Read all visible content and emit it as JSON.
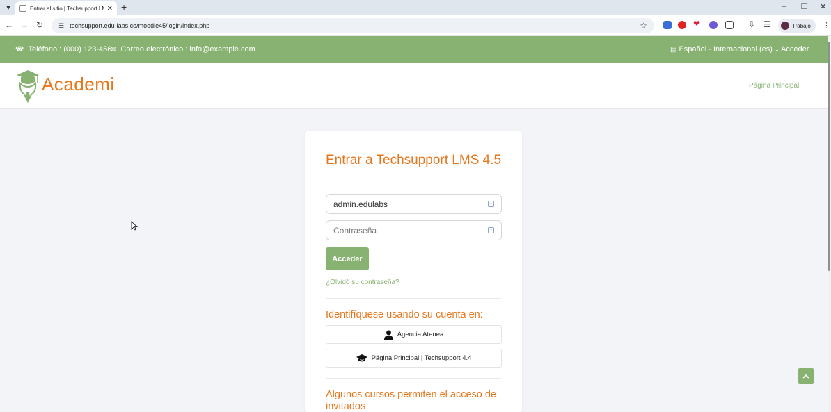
{
  "browser": {
    "tab_title": "Entrar al sitio | Techsupport LMS",
    "url": "techsupport.edu-labs.co/moodle45/login/index.php",
    "profile_label": "Trabajo"
  },
  "topbar": {
    "phone": "Teléfono : (000) 123-456",
    "email": "Correo electrónico : info@example.com",
    "language": "Español - Internacional (es)",
    "login_link": "Acceder"
  },
  "header": {
    "logo_text": "Academi",
    "home_link": "Página Principal"
  },
  "login": {
    "title": "Entrar a Techsupport LMS 4.5",
    "username_value": "admin.edulabs",
    "password_placeholder": "Contraseña",
    "submit_label": "Acceder",
    "forgot_link": "¿Olvidó su contraseña?",
    "identify_heading": "Identifíquese usando su cuenta en:",
    "providers": [
      {
        "label": "Agencia Atenea",
        "icon": "user-icon"
      },
      {
        "label": "Página Principal | Techsupport 4.4",
        "icon": "graduation-cap-icon"
      }
    ],
    "guest_heading": "Algunos cursos permiten el acceso de invitados"
  },
  "colors": {
    "accent_green": "#88b272",
    "brand_orange": "#e8761b"
  }
}
